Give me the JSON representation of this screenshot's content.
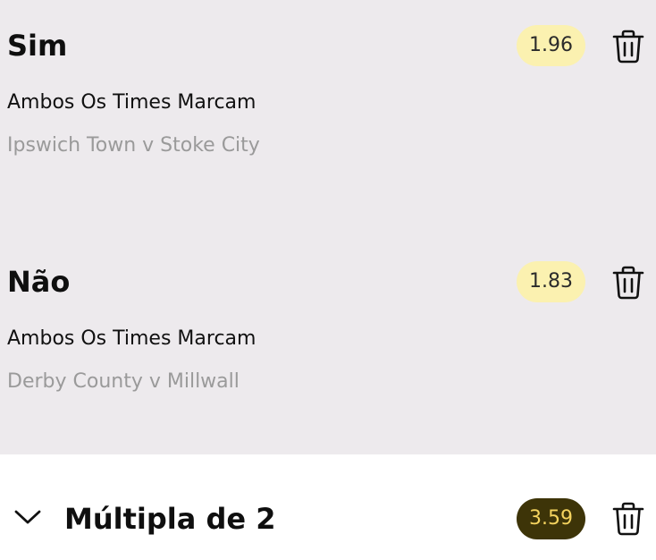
{
  "bets": [
    {
      "selection": "Sim",
      "market": "Ambos Os Times Marcam",
      "event": "Ipswich Town v Stoke City",
      "odds": "1.96"
    },
    {
      "selection": "Não",
      "market": "Ambos Os Times Marcam",
      "event": "Derby County v Millwall",
      "odds": "1.83"
    }
  ],
  "multiple": {
    "title": "Múltipla de 2",
    "total_odds": "3.59"
  },
  "icons": {
    "delete": "trash-icon",
    "expand": "chevron-down-icon"
  },
  "colors": {
    "bets_background": "#edeaed",
    "odds_pill": "#fbf1b0",
    "total_pill": "#3d3408",
    "total_text": "#f4d35e"
  }
}
